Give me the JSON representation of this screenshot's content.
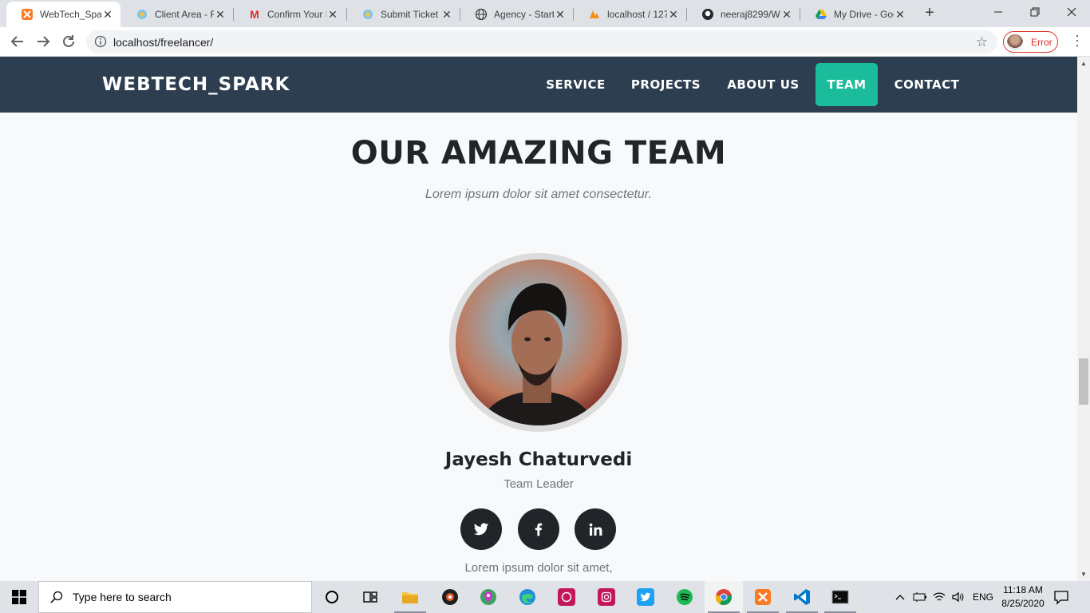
{
  "browser": {
    "tabs": [
      {
        "label": "WebTech_Spar",
        "icon": "xampp-icon",
        "active": true
      },
      {
        "label": "Client Area - Fr",
        "icon": "client-area-icon"
      },
      {
        "label": "Confirm Your F",
        "icon": "gmail-icon"
      },
      {
        "label": "Submit Ticket",
        "icon": "client-area-icon"
      },
      {
        "label": "Agency - Start",
        "icon": "globe-icon"
      },
      {
        "label": "localhost / 127",
        "icon": "phpmyadmin-icon"
      },
      {
        "label": "neeraj8299/We",
        "icon": "github-icon"
      },
      {
        "label": "My Drive - Goo",
        "icon": "google-drive-icon"
      }
    ],
    "address": "localhost/freelancer/",
    "profile_status": "Error"
  },
  "site": {
    "brand": "WEBTECH_SPARK",
    "nav": [
      {
        "label": "SERVICE"
      },
      {
        "label": "PROJECTS"
      },
      {
        "label": "ABOUT US"
      },
      {
        "label": "TEAM",
        "active": true
      },
      {
        "label": "CONTACT"
      }
    ],
    "accent_color": "#1abc9c",
    "nav_bg_color": "#2c3e50"
  },
  "team": {
    "title": "OUR AMAZING TEAM",
    "subtitle": "Lorem ipsum dolor sit amet consectetur.",
    "member": {
      "name": "Jayesh Chaturvedi",
      "role": "Team Leader",
      "social": [
        "twitter-icon",
        "facebook-icon",
        "linkedin-icon"
      ],
      "description": "Lorem ipsum dolor sit amet,"
    }
  },
  "taskbar": {
    "search_placeholder": "Type here to search",
    "language": "ENG",
    "time": "11:18 AM",
    "date": "8/25/2020"
  }
}
